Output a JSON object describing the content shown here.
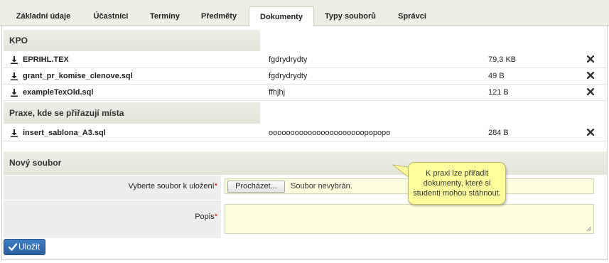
{
  "tabs": [
    {
      "label": "Základní údaje",
      "active": false
    },
    {
      "label": "Účastníci",
      "active": false
    },
    {
      "label": "Termíny",
      "active": false
    },
    {
      "label": "Předměty",
      "active": false
    },
    {
      "label": "Dokumenty",
      "active": true
    },
    {
      "label": "Typy souborů",
      "active": false
    },
    {
      "label": "Správci",
      "active": false
    }
  ],
  "groups": [
    {
      "title": "KPO",
      "files": [
        {
          "name": "EPRIHL.TEX",
          "description": "fgdrydrydty",
          "size": "79,3 KB"
        },
        {
          "name": "grant_pr_komise_clenove.sql",
          "description": "fgdrydrydty",
          "size": "49 B"
        },
        {
          "name": "exampleTexOld.sql",
          "description": "ffhjhj",
          "size": "121 B"
        }
      ]
    },
    {
      "title": "Praxe, kde se přiřazují místa",
      "files": [
        {
          "name": "insert_sablona_A3.sql",
          "description": "oooooooooooooooooooooopopopo",
          "size": "284 B"
        }
      ]
    }
  ],
  "new_file": {
    "title": "Nový soubor",
    "file_label": "Vyberte soubor k uložení",
    "browse_label": "Procházet...",
    "file_status": "Soubor nevybrán.",
    "description_label": "Popis",
    "required_mark": "*",
    "save_label": "Uložit"
  },
  "tooltip": {
    "line1": "K praxi lze přiřadit",
    "line2": "dokumenty, které si",
    "line3": "studenti mohou stáhnout."
  },
  "icons": {
    "download": "download-icon",
    "delete": "delete-x-icon",
    "check": "check-icon"
  },
  "colors": {
    "accent": "#2f6aad",
    "required": "#cc0000",
    "tooltip_bg": "#fefe9c",
    "field_bg": "#fdfde0"
  }
}
